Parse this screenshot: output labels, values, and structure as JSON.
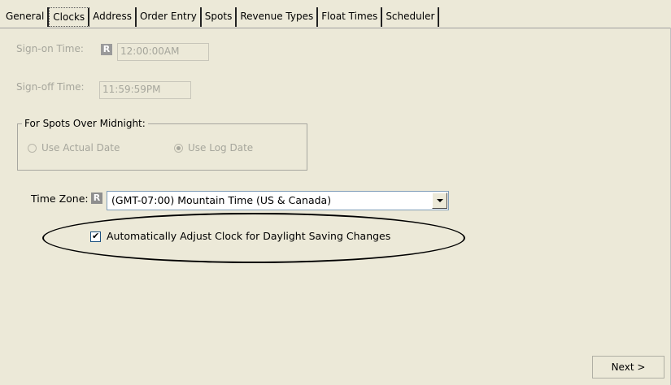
{
  "tabs": [
    {
      "label": "General",
      "active": false
    },
    {
      "label": "Clocks",
      "active": true
    },
    {
      "label": "Address",
      "active": false
    },
    {
      "label": "Order Entry",
      "active": false
    },
    {
      "label": "Spots",
      "active": false
    },
    {
      "label": "Revenue Types",
      "active": false
    },
    {
      "label": "Float Times",
      "active": false
    },
    {
      "label": "Scheduler",
      "active": false
    }
  ],
  "clocks": {
    "sign_on_label": "Sign-on Time:",
    "sign_on_badge": "R",
    "sign_on_value": "12:00:00AM",
    "sign_off_label": "Sign-off Time:",
    "sign_off_value": "11:59:59PM",
    "midnight_group_label": "For Spots Over Midnight:",
    "option_actual_date": "Use Actual Date",
    "option_log_date": "Use Log Date",
    "option_selected": "Use Log Date",
    "time_zone_label": "Time Zone:",
    "time_zone_badge": "R",
    "time_zone_value": "(GMT-07:00) Mountain Time (US & Canada)",
    "dst_label": "Automatically Adjust Clock for Daylight Saving Changes",
    "dst_checked": true,
    "dst_check_glyph": "✔"
  },
  "footer": {
    "next_label": "Next >"
  },
  "icons": {
    "combo": "chevron-down-icon",
    "badge": "r-badge-icon",
    "check": "check-icon"
  },
  "colors": {
    "background": "#ece9d8",
    "disabled_text": "#a6a69c",
    "input_border": "#7f9db9"
  }
}
